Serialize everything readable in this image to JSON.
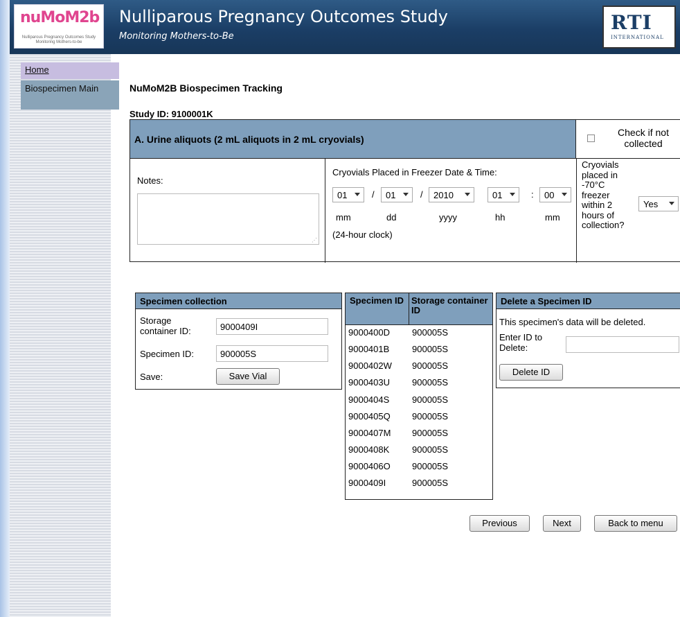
{
  "header": {
    "logo_text": "nuMoM2b",
    "logo_sub": "Nulliparous Pregnancy Outcomes Study Monitoring Mothers-to-be",
    "title": "Nulliparous Pregnancy Outcomes Study",
    "subtitle": "Monitoring Mothers-to-Be",
    "rti_logo": "RTI",
    "rti_sub": "INTERNATIONAL"
  },
  "sidebar": {
    "items": [
      {
        "label": "Home"
      },
      {
        "label": "Biospecimen Main"
      }
    ]
  },
  "main": {
    "title": "NuMoM2B Biospecimen Tracking",
    "study_id": "Study ID: 9100001K"
  },
  "section": {
    "heading": "A. Urine aliquots (2 mL aliquots in 2 mL cryovials)",
    "not_collected_label": "Check if not collected",
    "notes_label": "Notes:",
    "notes_value": "",
    "freezer_label": "Cryovials Placed in Freezer Date & Time:",
    "date": {
      "mm": "01",
      "dd": "01",
      "yyyy": "2010",
      "hh": "01",
      "min": "00"
    },
    "units": {
      "mm": "mm",
      "dd": "dd",
      "yyyy": "yyyy",
      "hh": "hh",
      "min": "mm"
    },
    "separators": {
      "slash": "/",
      "colon": ":"
    },
    "clock_note": "(24-hour clock)",
    "cryo_question": "Cryovials placed in -70°C freezer within 2 hours of collection?",
    "cryo_answer": "Yes"
  },
  "collection": {
    "heading": "Specimen collection",
    "storage_label": "Storage container ID:",
    "storage_value": "9000409I",
    "specimen_label": "Specimen ID:",
    "specimen_value": "900005S",
    "save_label": "Save:",
    "save_button": "Save Vial"
  },
  "specimen_table": {
    "headers": [
      "Specimen ID",
      "Storage container ID"
    ],
    "rows": [
      [
        "9000400D",
        "900005S"
      ],
      [
        "9000401B",
        "900005S"
      ],
      [
        "9000402W",
        "900005S"
      ],
      [
        "9000403U",
        "900005S"
      ],
      [
        "9000404S",
        "900005S"
      ],
      [
        "9000405Q",
        "900005S"
      ],
      [
        "9000407M",
        "900005S"
      ],
      [
        "9000408K",
        "900005S"
      ],
      [
        "9000406O",
        "900005S"
      ],
      [
        "9000409I",
        "900005S"
      ]
    ]
  },
  "delete": {
    "heading": "Delete a Specimen ID",
    "warning": "This specimen's data will be deleted.",
    "enter_label": "Enter ID to Delete:",
    "input_value": "",
    "button": "Delete ID"
  },
  "nav_buttons": {
    "previous": "Previous",
    "next": "Next",
    "back": "Back to menu"
  }
}
